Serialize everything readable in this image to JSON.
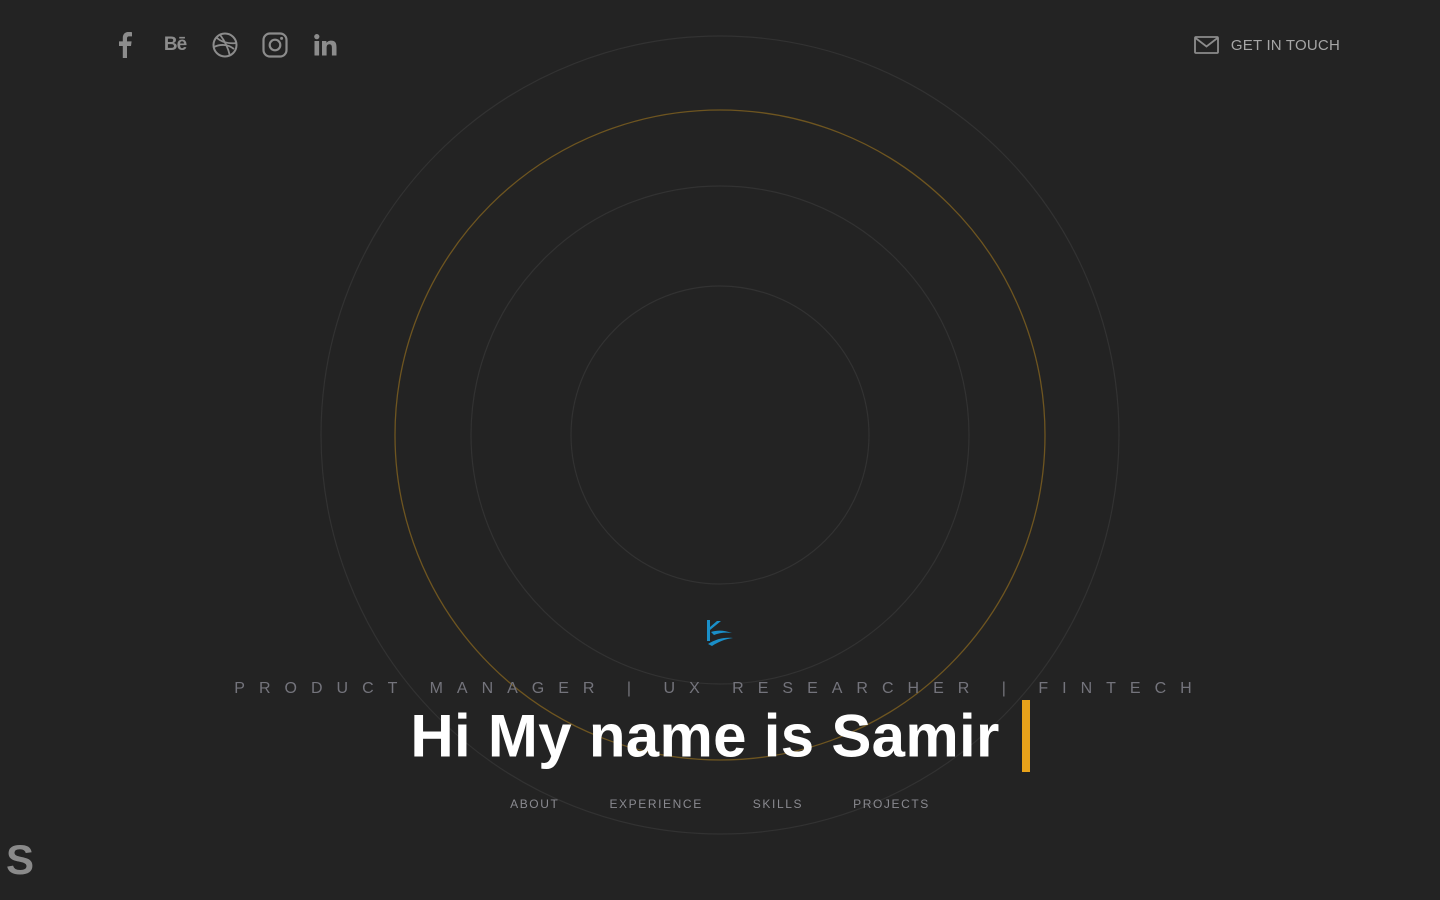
{
  "socials": [
    {
      "name": "facebook-icon"
    },
    {
      "name": "behance-icon",
      "glyph": "Bē"
    },
    {
      "name": "dribbble-icon"
    },
    {
      "name": "instagram-icon"
    },
    {
      "name": "linkedin-icon"
    }
  ],
  "contact": {
    "icon": "mail-icon",
    "label": "GET IN TOUCH"
  },
  "hero": {
    "roles": "PRODUCT MANAGER | UX RESEARCHER | FINTECH",
    "headline": "Hi My name is Samir"
  },
  "nav": {
    "items": [
      "ABOUT",
      "EXPERIENCE",
      "SKILLS",
      "PROJECTS"
    ]
  },
  "corner": {
    "letter": "S"
  },
  "colors": {
    "background": "#232323",
    "accent": "#e8a21a",
    "ring": "#333333",
    "logo": "#1a8fc8"
  }
}
